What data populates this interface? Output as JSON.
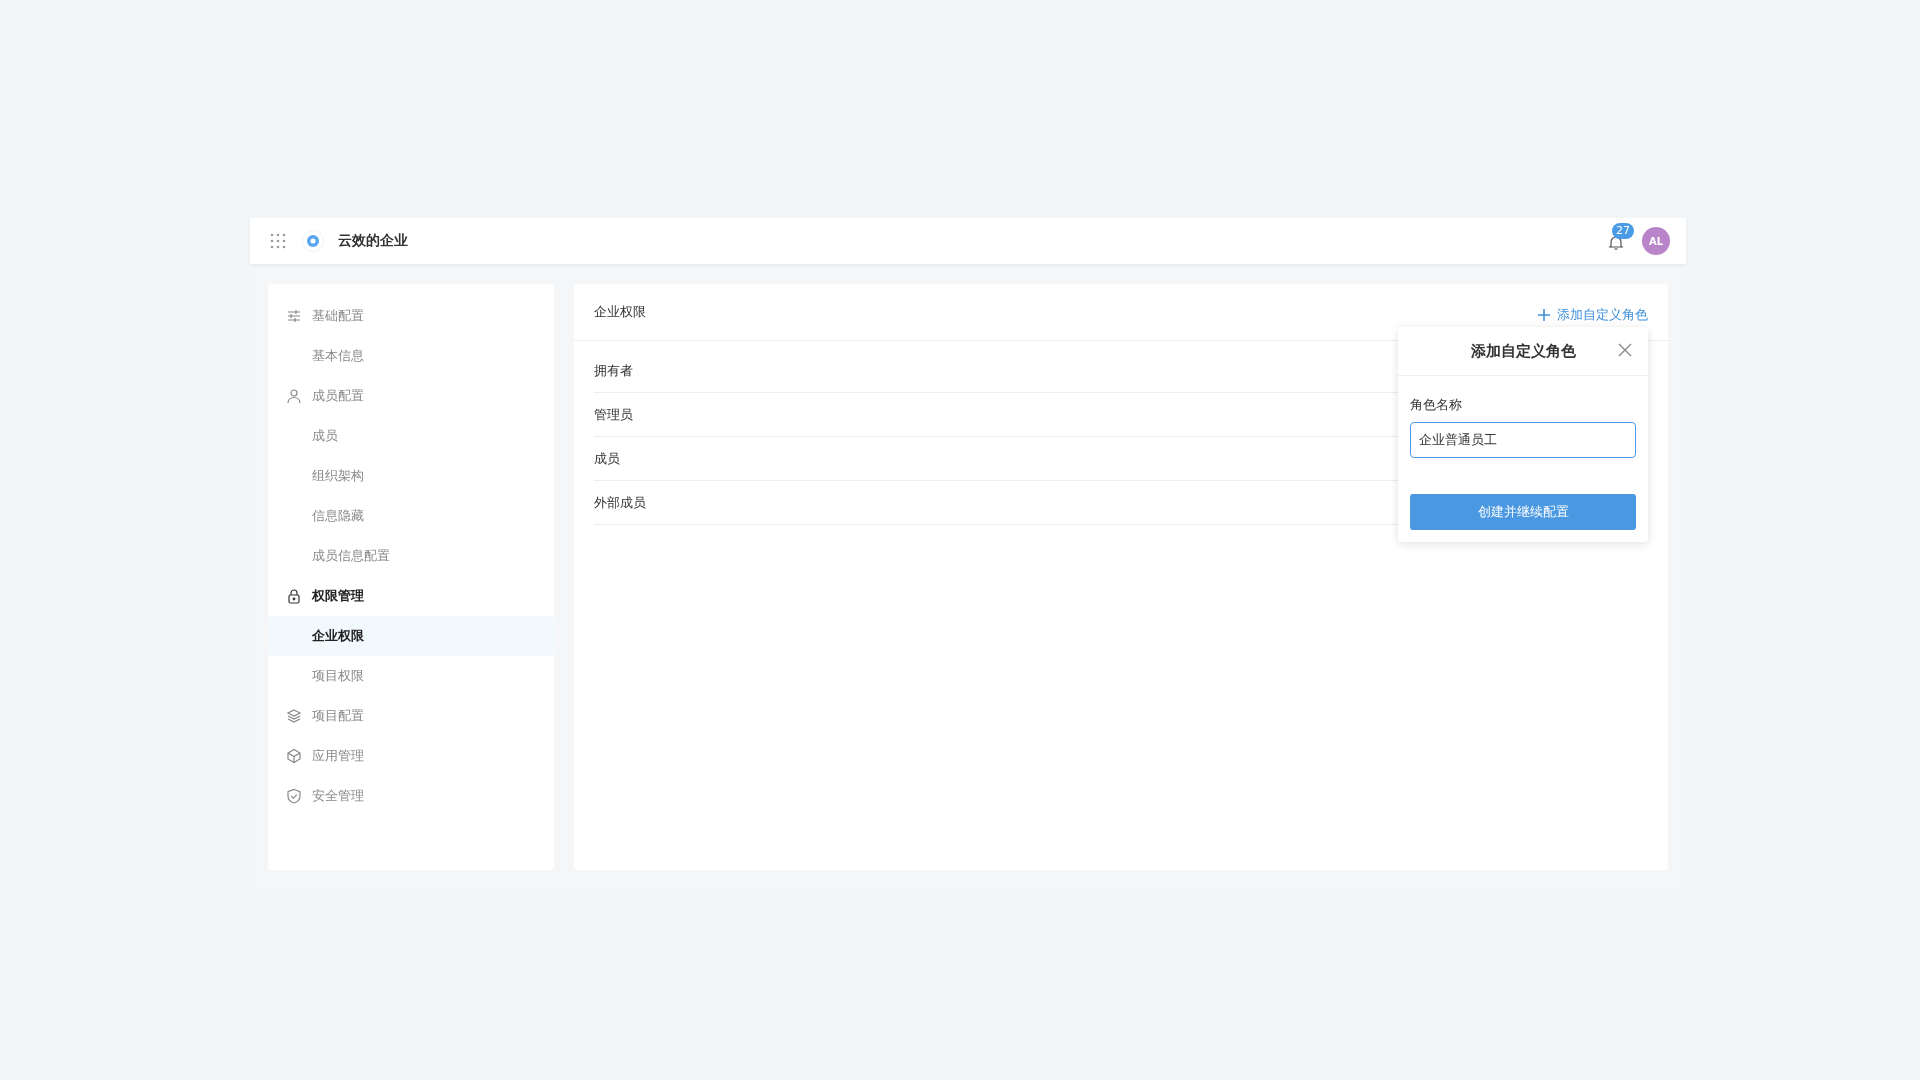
{
  "header": {
    "org_name": "云效的企业",
    "notification_count": "27",
    "avatar_initials": "AL"
  },
  "sidebar": {
    "groups": [
      {
        "label": "基础配置",
        "active": false,
        "children": [
          {
            "label": "基本信息",
            "selected": false
          }
        ]
      },
      {
        "label": "成员配置",
        "active": false,
        "children": [
          {
            "label": "成员",
            "selected": false
          },
          {
            "label": "组织架构",
            "selected": false
          },
          {
            "label": "信息隐藏",
            "selected": false
          },
          {
            "label": "成员信息配置",
            "selected": false
          }
        ]
      },
      {
        "label": "权限管理",
        "active": true,
        "children": [
          {
            "label": "企业权限",
            "selected": true
          },
          {
            "label": "项目权限",
            "selected": false
          }
        ]
      },
      {
        "label": "项目配置",
        "active": false
      },
      {
        "label": "应用管理",
        "active": false
      },
      {
        "label": "安全管理",
        "active": false
      }
    ]
  },
  "main": {
    "title": "企业权限",
    "add_link": "添加自定义角色",
    "roles": [
      "拥有者",
      "管理员",
      "成员",
      "外部成员"
    ]
  },
  "popover": {
    "title": "添加自定义角色",
    "field_label": "角色名称",
    "field_value": "企业普通员工",
    "submit": "创建并继续配置"
  }
}
